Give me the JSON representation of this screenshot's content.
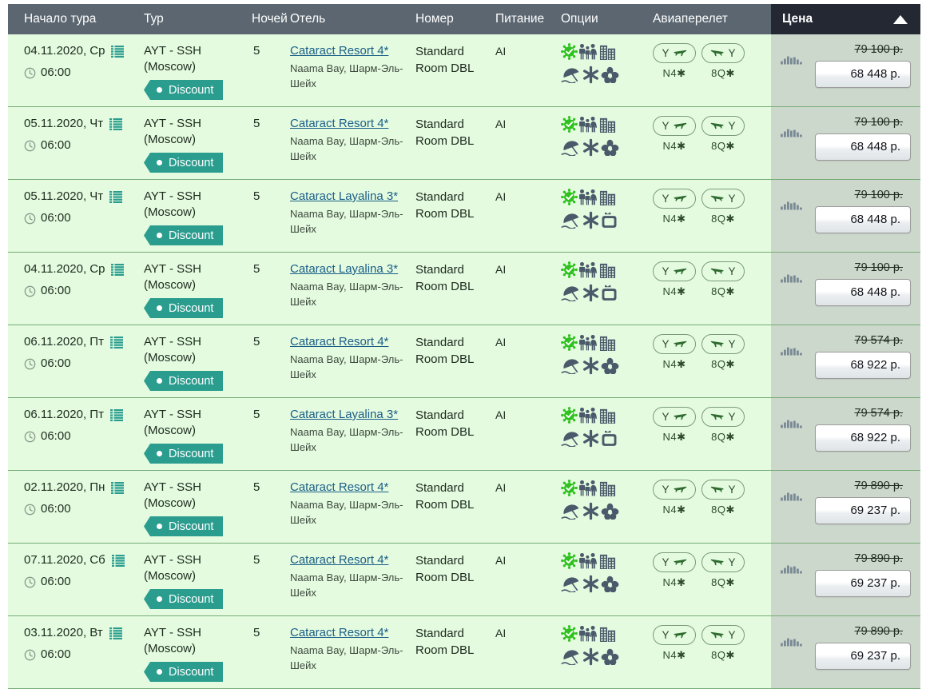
{
  "table": {
    "columns": [
      {
        "key": "start",
        "label": "Начало тура"
      },
      {
        "key": "tour",
        "label": "Тур"
      },
      {
        "key": "nights",
        "label": "Ночей"
      },
      {
        "key": "hotel",
        "label": "Отель"
      },
      {
        "key": "room",
        "label": "Номер"
      },
      {
        "key": "meal",
        "label": "Питание"
      },
      {
        "key": "opts",
        "label": "Опции"
      },
      {
        "key": "flight",
        "label": "Авиаперелет"
      },
      {
        "key": "price",
        "label": "Цена"
      }
    ],
    "sort": {
      "column": "price",
      "direction": "asc",
      "icon": "triangle-up-icon"
    },
    "colors": {
      "header_bg": "#5b6670",
      "header_price_bg": "#232832",
      "row_bg": "#e4fbe0",
      "price_cell_bg": "#cdd8cd",
      "row_border": "#76ab76",
      "badge_bg": "#2a9d8f",
      "link": "#1a5e87",
      "icon_dark": "#4a5a6a",
      "icon_green": "#2fc21f"
    },
    "rows": [
      {
        "date": "04.11.2020, Ср",
        "time": "06:00",
        "tour": "AYT - SSH (Moscow)",
        "badge": "Discount",
        "nights": "5",
        "hotel": "Cataract Resort 4*",
        "hotel_location": "Naama Bay, Шарм-Эль-Шейх",
        "room": "Standard Room DBL",
        "meal": "AI",
        "options": [
          "covid-check-icon",
          "family-icon",
          "building-icon",
          "beach-umbrella-icon",
          "snowflake-icon",
          "flower-icon"
        ],
        "flight_out": {
          "class": "Y",
          "code": "N4✱"
        },
        "flight_back": {
          "class": "Y",
          "code": "8Q✱"
        },
        "old_price": "79 100 р.",
        "price": "68 448 р."
      },
      {
        "date": "05.11.2020, Чт",
        "time": "06:00",
        "tour": "AYT - SSH (Moscow)",
        "badge": "Discount",
        "nights": "5",
        "hotel": "Cataract Resort 4*",
        "hotel_location": "Naama Bay, Шарм-Эль-Шейх",
        "room": "Standard Room DBL",
        "meal": "AI",
        "options": [
          "covid-check-icon",
          "family-icon",
          "building-icon",
          "beach-umbrella-icon",
          "snowflake-icon",
          "flower-icon"
        ],
        "flight_out": {
          "class": "Y",
          "code": "N4✱"
        },
        "flight_back": {
          "class": "Y",
          "code": "8Q✱"
        },
        "old_price": "79 100 р.",
        "price": "68 448 р."
      },
      {
        "date": "05.11.2020, Чт",
        "time": "06:00",
        "tour": "AYT - SSH (Moscow)",
        "badge": "Discount",
        "nights": "5",
        "hotel": "Cataract Layalina 3*",
        "hotel_location": "Naama Bay, Шарм-Эль-Шейх",
        "room": "Standard Room DBL",
        "meal": "AI",
        "options": [
          "covid-check-icon",
          "family-icon",
          "building-icon",
          "beach-umbrella-icon",
          "snowflake-icon",
          "purse-icon"
        ],
        "flight_out": {
          "class": "Y",
          "code": "N4✱"
        },
        "flight_back": {
          "class": "Y",
          "code": "8Q✱"
        },
        "old_price": "79 100 р.",
        "price": "68 448 р."
      },
      {
        "date": "04.11.2020, Ср",
        "time": "06:00",
        "tour": "AYT - SSH (Moscow)",
        "badge": "Discount",
        "nights": "5",
        "hotel": "Cataract Layalina 3*",
        "hotel_location": "Naama Bay, Шарм-Эль-Шейх",
        "room": "Standard Room DBL",
        "meal": "AI",
        "options": [
          "covid-check-icon",
          "family-icon",
          "building-icon",
          "beach-umbrella-icon",
          "snowflake-icon",
          "purse-icon"
        ],
        "flight_out": {
          "class": "Y",
          "code": "N4✱"
        },
        "flight_back": {
          "class": "Y",
          "code": "8Q✱"
        },
        "old_price": "79 100 р.",
        "price": "68 448 р."
      },
      {
        "date": "06.11.2020, Пт",
        "time": "06:00",
        "tour": "AYT - SSH (Moscow)",
        "badge": "Discount",
        "nights": "5",
        "hotel": "Cataract Resort 4*",
        "hotel_location": "Naama Bay, Шарм-Эль-Шейх",
        "room": "Standard Room DBL",
        "meal": "AI",
        "options": [
          "covid-check-icon",
          "family-icon",
          "building-icon",
          "beach-umbrella-icon",
          "snowflake-icon",
          "flower-icon"
        ],
        "flight_out": {
          "class": "Y",
          "code": "N4✱"
        },
        "flight_back": {
          "class": "Y",
          "code": "8Q✱"
        },
        "old_price": "79 574 р.",
        "price": "68 922 р."
      },
      {
        "date": "06.11.2020, Пт",
        "time": "06:00",
        "tour": "AYT - SSH (Moscow)",
        "badge": "Discount",
        "nights": "5",
        "hotel": "Cataract Layalina 3*",
        "hotel_location": "Naama Bay, Шарм-Эль-Шейх",
        "room": "Standard Room DBL",
        "meal": "AI",
        "options": [
          "covid-check-icon",
          "family-icon",
          "building-icon",
          "beach-umbrella-icon",
          "snowflake-icon",
          "purse-icon"
        ],
        "flight_out": {
          "class": "Y",
          "code": "N4✱"
        },
        "flight_back": {
          "class": "Y",
          "code": "8Q✱"
        },
        "old_price": "79 574 р.",
        "price": "68 922 р."
      },
      {
        "date": "02.11.2020, Пн",
        "time": "06:00",
        "tour": "AYT - SSH (Moscow)",
        "badge": "Discount",
        "nights": "5",
        "hotel": "Cataract Resort 4*",
        "hotel_location": "Naama Bay, Шарм-Эль-Шейх",
        "room": "Standard Room DBL",
        "meal": "AI",
        "options": [
          "covid-check-icon",
          "family-icon",
          "building-icon",
          "beach-umbrella-icon",
          "snowflake-icon",
          "flower-icon"
        ],
        "flight_out": {
          "class": "Y",
          "code": "N4✱"
        },
        "flight_back": {
          "class": "Y",
          "code": "8Q✱"
        },
        "old_price": "79 890 р.",
        "price": "69 237 р."
      },
      {
        "date": "07.11.2020, Сб",
        "time": "06:00",
        "tour": "AYT - SSH (Moscow)",
        "badge": "Discount",
        "nights": "5",
        "hotel": "Cataract Resort 4*",
        "hotel_location": "Naama Bay, Шарм-Эль-Шейх",
        "room": "Standard Room DBL",
        "meal": "AI",
        "options": [
          "covid-check-icon",
          "family-icon",
          "building-icon",
          "beach-umbrella-icon",
          "snowflake-icon",
          "flower-icon"
        ],
        "flight_out": {
          "class": "Y",
          "code": "N4✱"
        },
        "flight_back": {
          "class": "Y",
          "code": "8Q✱"
        },
        "old_price": "79 890 р.",
        "price": "69 237 р."
      },
      {
        "date": "03.11.2020, Вт",
        "time": "06:00",
        "tour": "AYT - SSH (Moscow)",
        "badge": "Discount",
        "nights": "5",
        "hotel": "Cataract Resort 4*",
        "hotel_location": "Naama Bay, Шарм-Эль-Шейх",
        "room": "Standard Room DBL",
        "meal": "AI",
        "options": [
          "covid-check-icon",
          "family-icon",
          "building-icon",
          "beach-umbrella-icon",
          "snowflake-icon",
          "flower-icon"
        ],
        "flight_out": {
          "class": "Y",
          "code": "N4✱"
        },
        "flight_back": {
          "class": "Y",
          "code": "8Q✱"
        },
        "old_price": "79 890 р.",
        "price": "69 237 р."
      }
    ]
  }
}
